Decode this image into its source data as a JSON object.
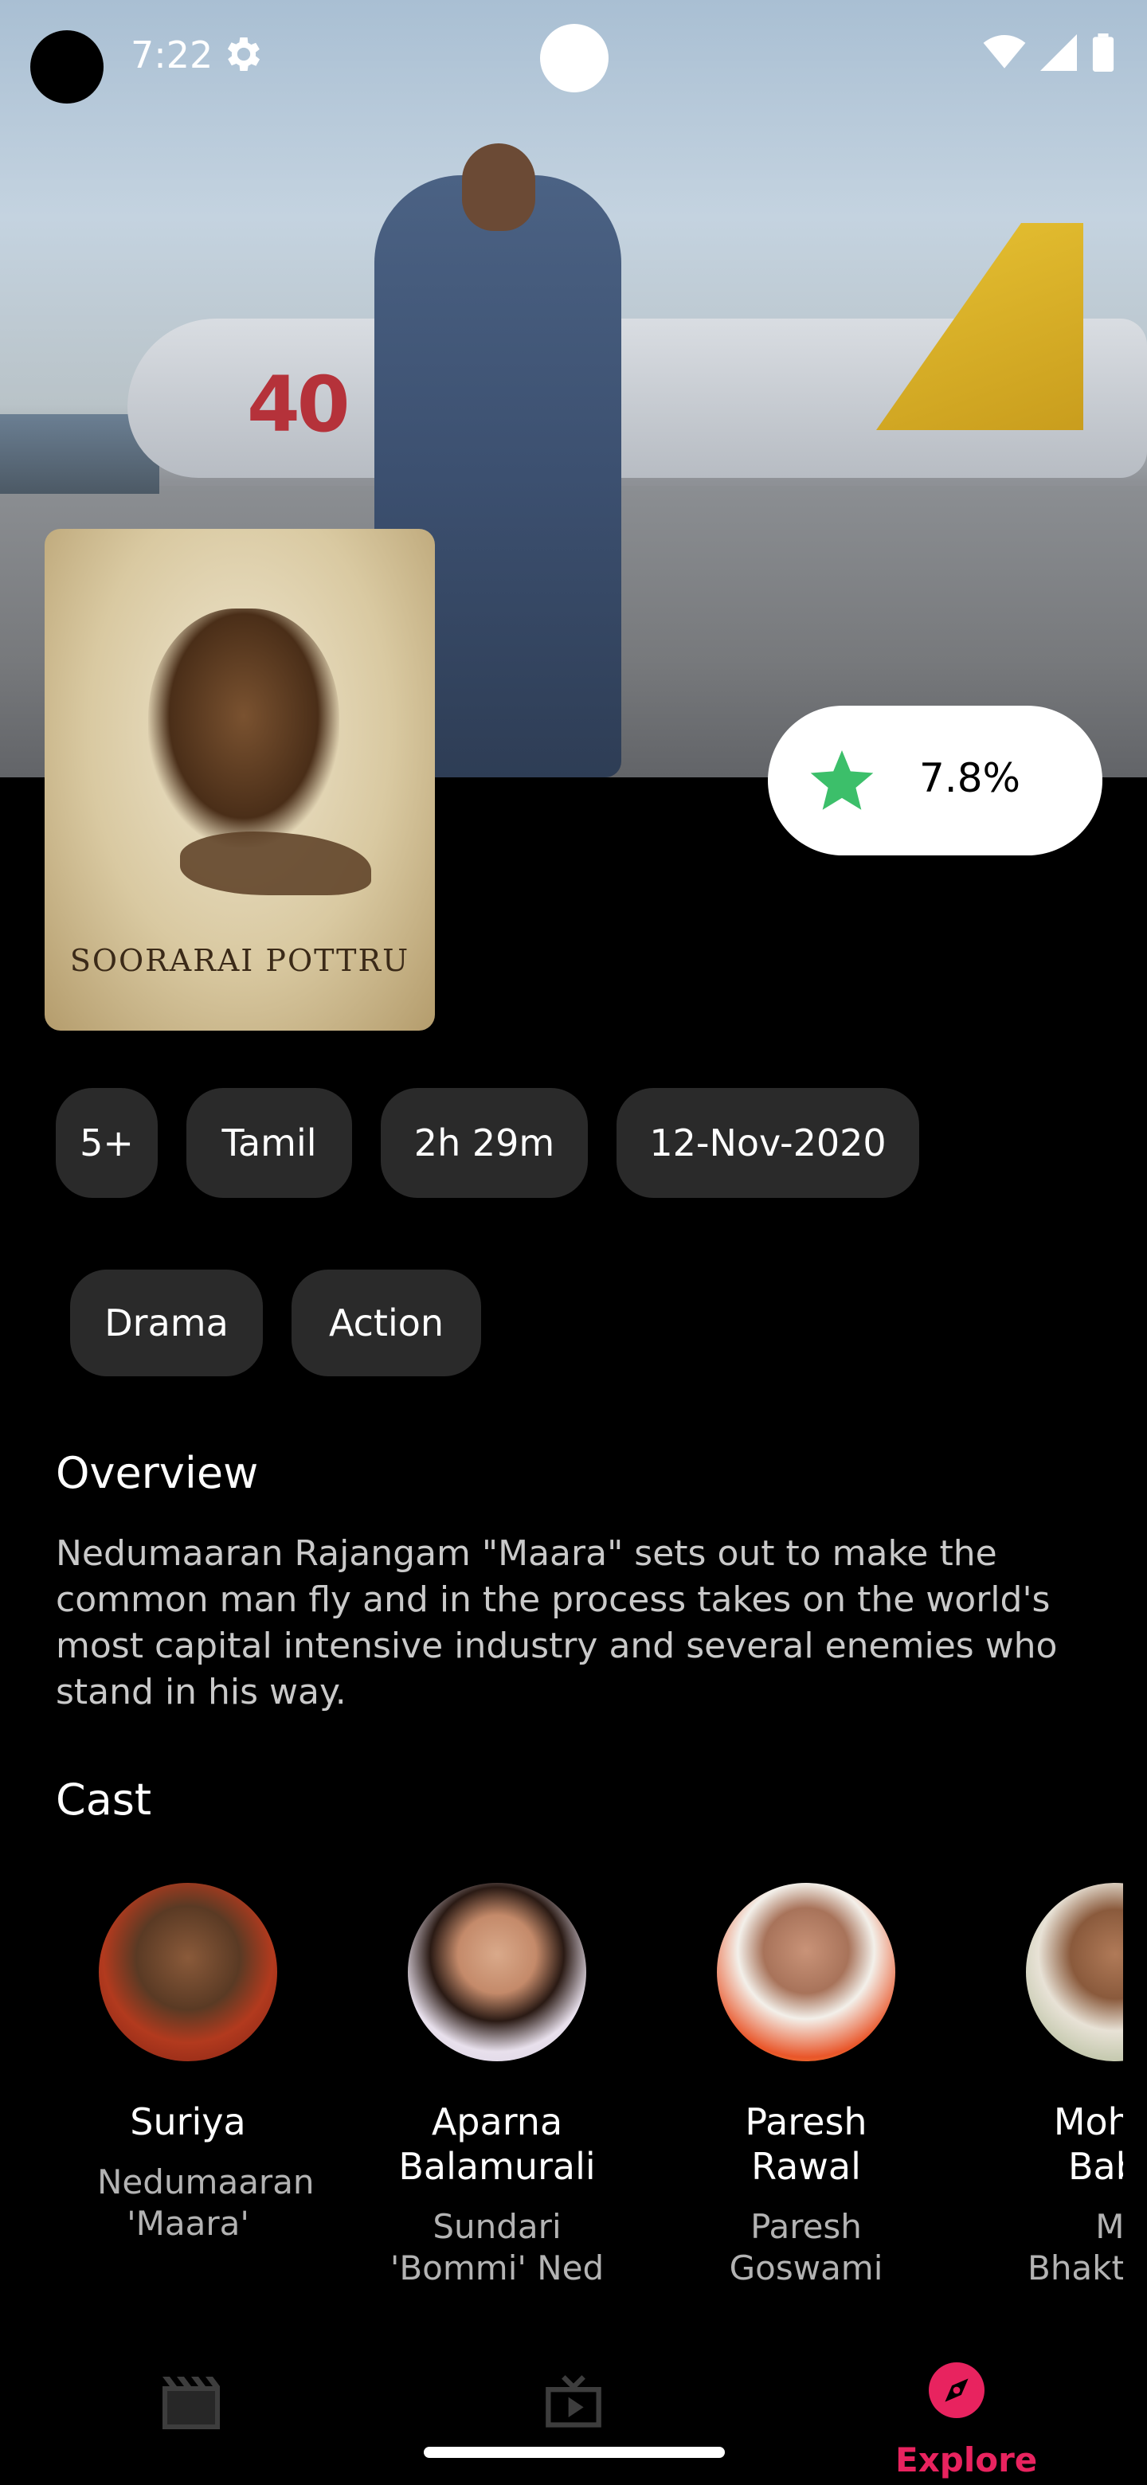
{
  "status_bar": {
    "time": "7:22"
  },
  "movie": {
    "poster_title": "SOORARAI POTTRU",
    "rating": "7.8%",
    "chips": [
      "5+",
      "Tamil",
      "2h 29m",
      "12-Nov-2020"
    ],
    "genres": [
      "Drama",
      "Action"
    ],
    "overview_heading": "Overview",
    "overview_text": "Nedumaaran Rajangam \"Maara\" sets out to make the common man fly and in the process takes on the world's most capital intensive industry and several enemies who stand in his way.",
    "cast_heading": "Cast"
  },
  "cast": [
    {
      "name": "Suriya",
      "role": "Nedumaaran 'Maara'"
    },
    {
      "name": "Aparna Balamurali",
      "role": "Sundari 'Bommi' Ned"
    },
    {
      "name": "Paresh Rawal",
      "role": "Paresh Goswami"
    },
    {
      "name": "Mohan Babu",
      "role": "M. Bhaktavatsa"
    }
  ],
  "nav": {
    "explore_label": "Explore",
    "items": [
      "movies-icon",
      "tv-icon",
      "explore-compass-icon"
    ],
    "active": "Explore"
  },
  "colors": {
    "accent": "#e8235f",
    "rating_star": "#3cbf6a",
    "chip_bg": "#2a2a2a",
    "background": "#000000"
  }
}
